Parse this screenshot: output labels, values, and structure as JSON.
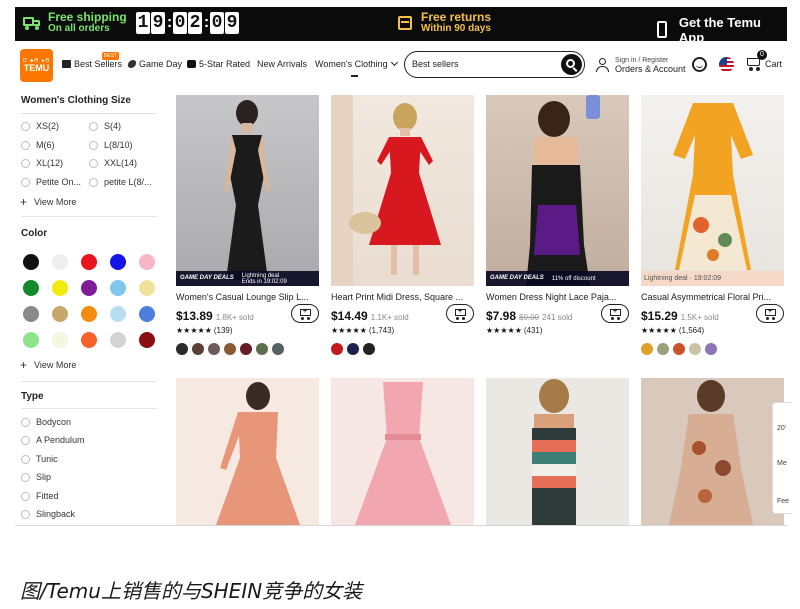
{
  "banner": {
    "shipping_title": "Free shipping",
    "shipping_sub": "On all orders",
    "timer_digits": [
      "1",
      "9",
      "0",
      "2",
      "0",
      "9"
    ],
    "returns_title": "Free returns",
    "returns_sub": "Within 90 days",
    "app_label": "Get the Temu App"
  },
  "nav": {
    "logo_top": "Ʊ ♣Ɵ ♠Ɵ",
    "logo_text": "TEMU",
    "best_badge": "BEST",
    "items": [
      "Best Sellers",
      "Game Day",
      "5-Star Rated",
      "New Arrivals",
      "Women's Clothing"
    ],
    "search_value": "Best sellers",
    "account_line1": "Sign in / Register",
    "account_line2": "Orders & Account",
    "cart_count": "0",
    "cart_label": "Cart"
  },
  "filters": {
    "size_title": "Women's Clothing Size",
    "sizes": [
      "XS(2)",
      "S(4)",
      "M(6)",
      "L(8/10)",
      "XL(12)",
      "XXL(14)",
      "Petite On...",
      "petite L(8/..."
    ],
    "view_more": "View More",
    "color_title": "Color",
    "colors": [
      "#111111",
      "#eeeeee",
      "#e8141e",
      "#1414e6",
      "#f6b6c6",
      "#118a2a",
      "#f2ea10",
      "#7f1c9a",
      "#7cc7ea",
      "#efe39a",
      "#8a8a8a",
      "#c9a76a",
      "#f28d0f",
      "#b8dff0",
      "#4e7fe0",
      "#8ee489",
      "#f4f6e0",
      "#f7622a",
      "#d4d4d4",
      "#8b0e14"
    ],
    "type_title": "Type",
    "types": [
      "Bodycon",
      "A Pendulum",
      "Tunic",
      "Slip",
      "Fitted",
      "Slingback"
    ]
  },
  "products": [
    {
      "name": "Women's Casual Lounge Slip L...",
      "price": "$13.89",
      "was": "",
      "sold": "1.8K+ sold",
      "stars": "★★★★★",
      "reviews": "(139)",
      "deal_tag": "GAME DAY DEALS",
      "deal_info_1": "Lightning deal",
      "deal_info_2": "Ends in 19:02:09",
      "swatches": [
        "#2b2b2b",
        "#5a3d34",
        "#6e5a5a",
        "#8a5a34",
        "#6a1a24",
        "#5c6e4c",
        "#556060"
      ]
    },
    {
      "name": "Heart Print Midi Dress, Square ...",
      "price": "$14.49",
      "was": "",
      "sold": "1.1K+ sold",
      "stars": "★★★★★",
      "reviews": "(1,743)",
      "deal_tag": "",
      "deal_info_1": "",
      "deal_info_2": "",
      "swatches": [
        "#c41a1e",
        "#1c2152",
        "#222222"
      ]
    },
    {
      "name": "Women Dress Night Lace Paja...",
      "price": "$7.98",
      "was": "$9.00",
      "sold": "241 sold",
      "stars": "★★★★★",
      "reviews": "(431)",
      "deal_tag": "GAME DAY DEALS",
      "deal_info_1": "11% off discount",
      "deal_info_2": "",
      "swatches": []
    },
    {
      "name": "Casual Asymmetrical Floral Pri...",
      "price": "$15.29",
      "was": "",
      "sold": "1.5K+ sold",
      "stars": "★★★★★",
      "reviews": "(1,564)",
      "deal_tag": "",
      "deal_info_1": "Lightning deal · 19:02:09",
      "deal_info_2": "",
      "swatches": [
        "#e0a12a",
        "#9aa07c",
        "#c9542a",
        "#c8c2a6",
        "#8c74b6"
      ]
    }
  ],
  "edge_panel": [
    "20'",
    "Me",
    "Fee"
  ],
  "caption": "图/Temu上销售的与SHEIN竞争的女装"
}
